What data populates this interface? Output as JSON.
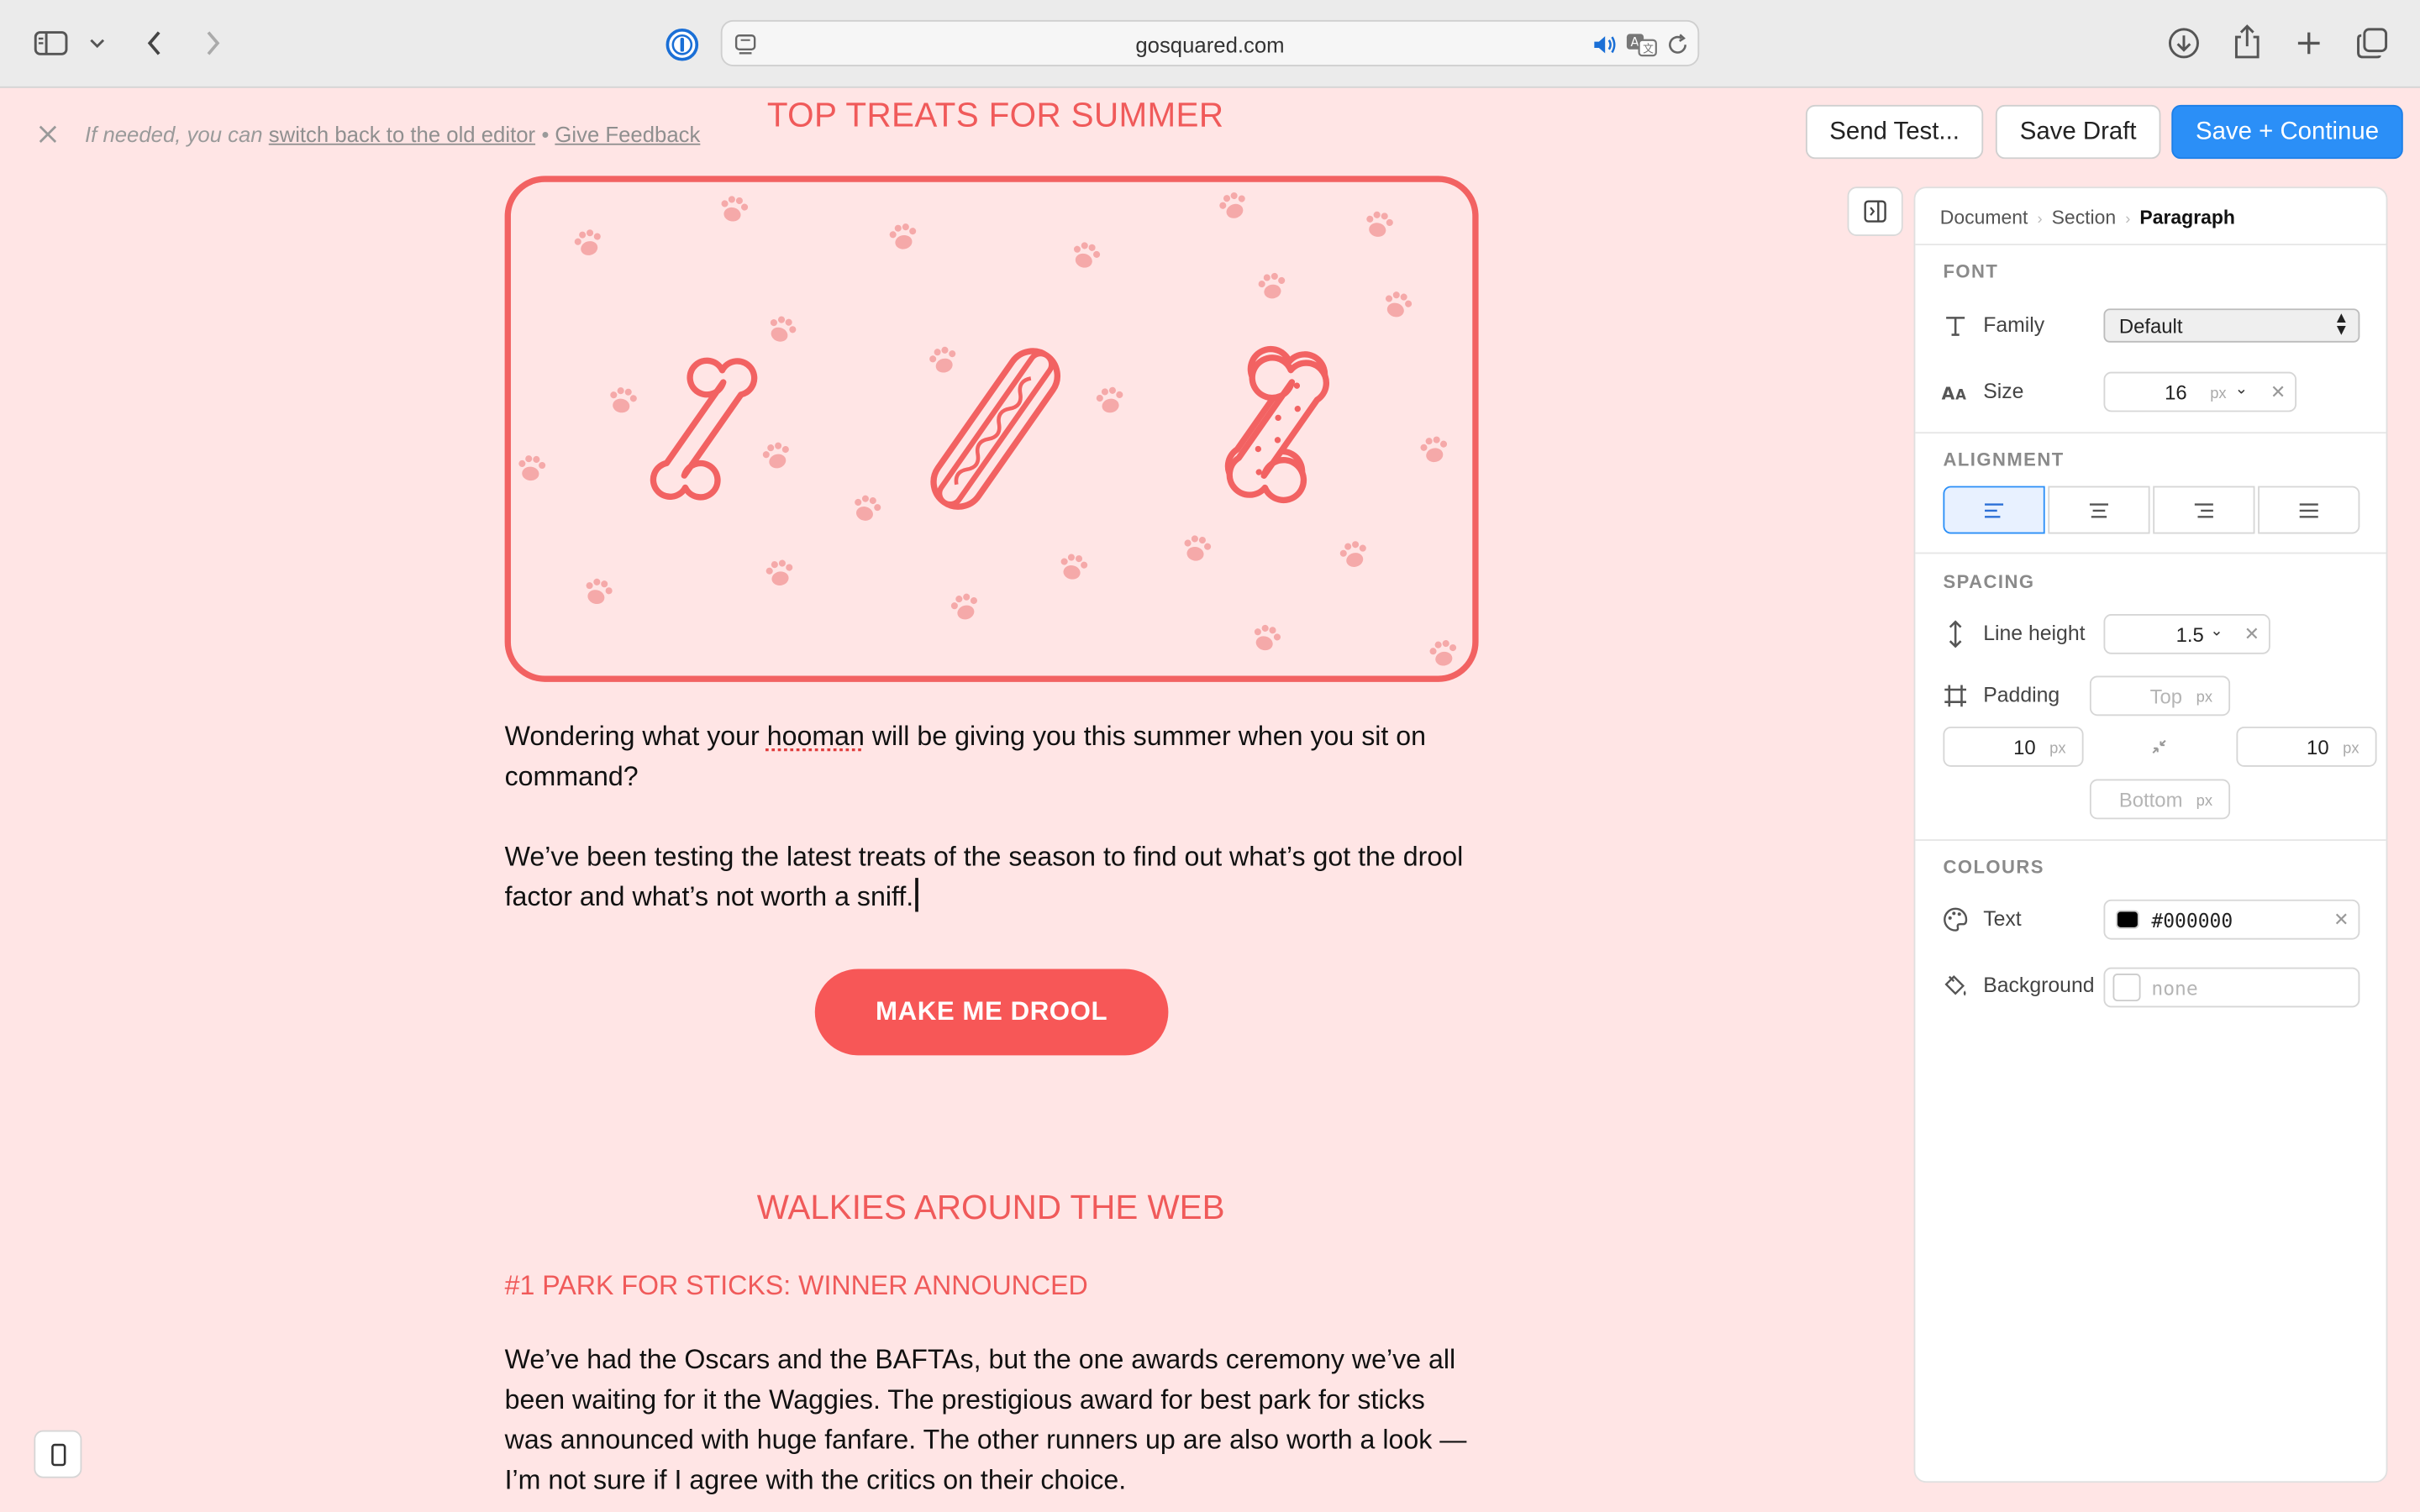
{
  "browser": {
    "url": "gosquared.com"
  },
  "editor": {
    "note_prefix": "If needed, you can ",
    "switch_link": "switch back to the old editor",
    "bullet": " • ",
    "feedback_link": "Give Feedback",
    "buttons": {
      "send_test": "Send Test...",
      "save_draft": "Save Draft",
      "save_continue": "Save + Continue"
    }
  },
  "email": {
    "heading": "TOP TREATS FOR SUMMER",
    "para1_a": "Wondering what your ",
    "para1_word": "hooman",
    "para1_b": " will be giving you this summer when you sit on command?",
    "para2": "We’ve been testing the latest treats of the season to find out what’s got the drool factor and what’s not worth a sniff.",
    "cta": "MAKE ME DROOL",
    "section_heading": "WALKIES AROUND THE WEB",
    "article_title": "#1 PARK FOR STICKS: WINNER ANNOUNCED",
    "article_body": "We’ve had the Oscars and the BAFTAs, but the one awards ceremony we’ve all been waiting for it the Waggies. The prestigious award for best park for sticks was announced with huge fanfare. The other runners up are also worth a look — I’m not sure if I agree with the critics on their choice."
  },
  "panel": {
    "breadcrumb": [
      "Document",
      "Section",
      "Paragraph"
    ],
    "font": {
      "section": "FONT",
      "family_label": "Family",
      "family_value": "Default",
      "size_label": "Size",
      "size_value": "16",
      "unit": "px"
    },
    "alignment": {
      "section": "ALIGNMENT",
      "selected": "left"
    },
    "spacing": {
      "section": "SPACING",
      "line_height_label": "Line height",
      "line_height_value": "1.5",
      "padding_label": "Padding",
      "top_placeholder": "Top",
      "left_value": "10",
      "right_value": "10",
      "bottom_placeholder": "Bottom",
      "unit": "px"
    },
    "colours": {
      "section": "COLOURS",
      "text_label": "Text",
      "text_value": "#000000",
      "text_swatch": "#000000",
      "background_label": "Background",
      "background_value": "none"
    }
  },
  "colors": {
    "accent": "#f05a5a",
    "cta": "#f75757",
    "page_bg": "#ffe5e5",
    "primary_button": "#2b8ff7"
  },
  "icons": [
    "sidebar-icon",
    "chevron-down-icon",
    "back-icon",
    "forward-icon",
    "onepassword-icon",
    "reader-icon",
    "speaker-icon",
    "translate-icon",
    "reload-icon",
    "download-icon",
    "share-icon",
    "plus-icon",
    "tabs-icon",
    "close-icon",
    "bone-icon",
    "hotdog-icon",
    "biscuit-icon",
    "paw-icon",
    "mobile-icon",
    "panel-toggle-icon",
    "text-type-icon",
    "font-size-icon",
    "line-height-icon",
    "padding-icon",
    "compress-icon",
    "palette-icon",
    "paint-bucket-icon"
  ]
}
